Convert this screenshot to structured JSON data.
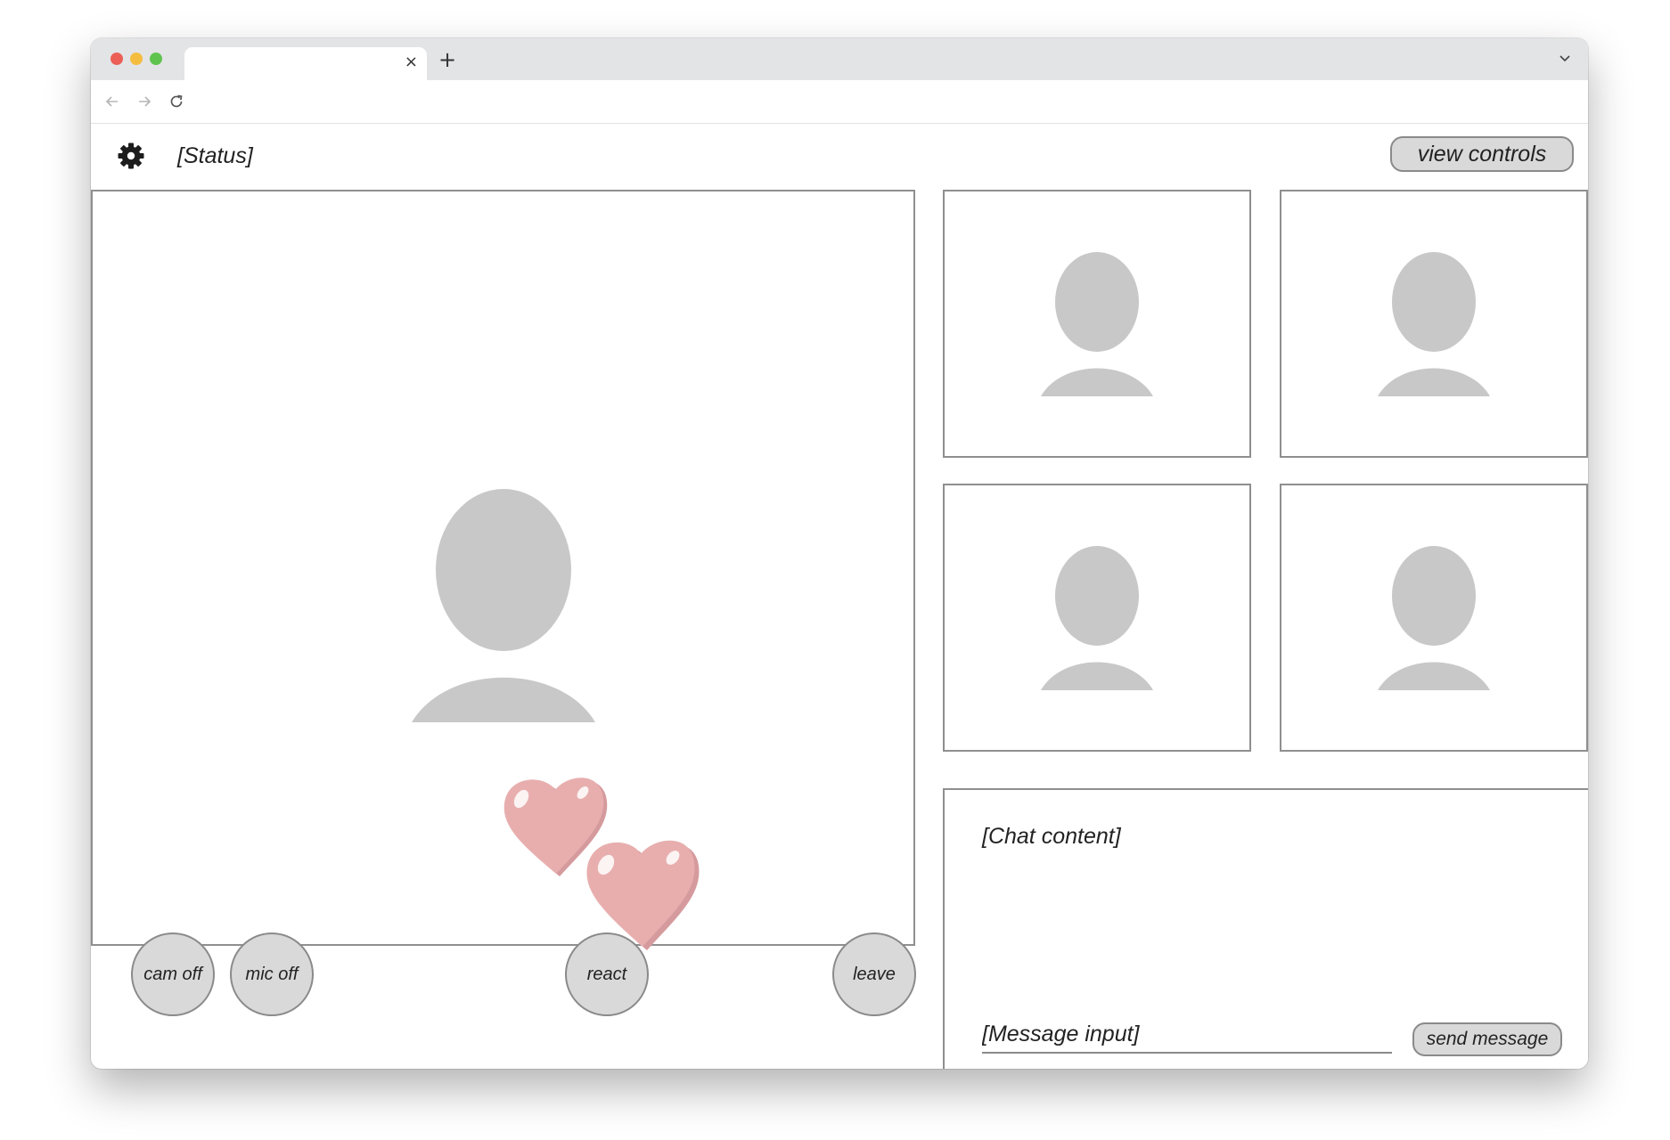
{
  "browser": {
    "tab_close_glyph": "×",
    "new_tab_glyph": "+",
    "icons": [
      "close-icon",
      "plus-icon",
      "chevron-down-icon",
      "arrow-left-icon",
      "arrow-right-icon",
      "reload-icon"
    ]
  },
  "header": {
    "status": "[Status]",
    "view_controls_label": "view controls",
    "icons": [
      "gear-icon"
    ]
  },
  "video": {
    "controls": {
      "cam_off_label": "cam off",
      "mic_off_label": "mic off",
      "react_label": "react",
      "leave_label": "leave"
    },
    "icons": [
      "avatar-icon",
      "heart-icon"
    ]
  },
  "chat": {
    "content_placeholder": "[Chat content]",
    "message_placeholder": "[Message input]",
    "send_label": "send message"
  },
  "colors": {
    "button_fill": "#d9d9d9",
    "button_border": "#8a8a8a",
    "avatar_fill": "#c8c8c8",
    "heart_fill": "#e8a9a9",
    "heart_shade": "#d08f93"
  }
}
